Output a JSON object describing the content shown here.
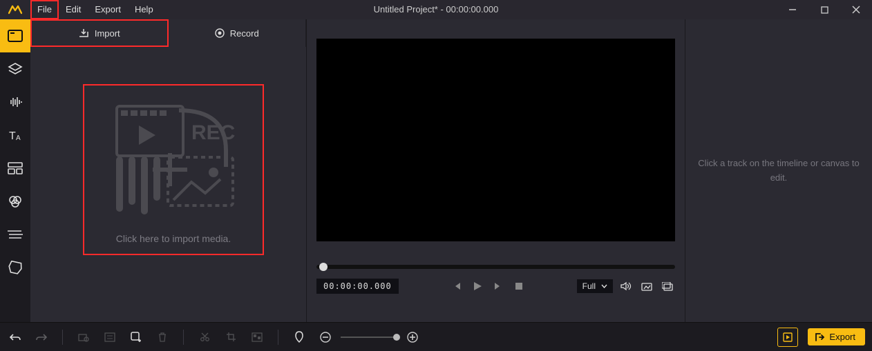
{
  "title": "Untitled Project* - 00:00:00.000",
  "menu": {
    "file": "File",
    "edit": "Edit",
    "export": "Export",
    "help": "Help"
  },
  "media_tabs": {
    "import": "Import",
    "record": "Record"
  },
  "dropzone_hint": "Click here to import media.",
  "player": {
    "timecode": "00:00:00.000",
    "size_label": "Full"
  },
  "properties_hint": "Click a track on the timeline or canvas to edit.",
  "bottom": {
    "export": "Export"
  }
}
